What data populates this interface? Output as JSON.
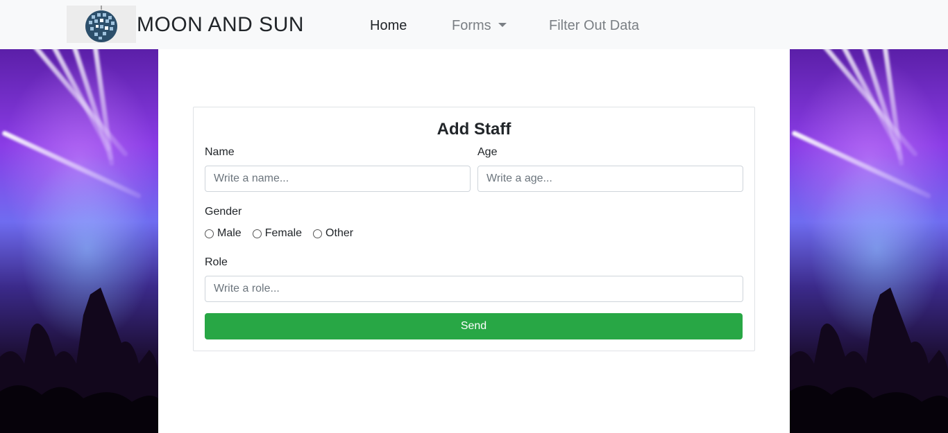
{
  "navbar": {
    "brand": "MOON AND SUN",
    "logo_icon": "disco-ball-icon",
    "links": [
      {
        "label": "Home",
        "active": true
      },
      {
        "label": "Forms",
        "dropdown": true
      },
      {
        "label": "Filter Out Data"
      }
    ]
  },
  "form": {
    "title": "Add Staff",
    "name_label": "Name",
    "name_placeholder": "Write a name...",
    "age_label": "Age",
    "age_placeholder": "Write a age...",
    "gender_label": "Gender",
    "gender_options": [
      "Male",
      "Female",
      "Other"
    ],
    "role_label": "Role",
    "role_placeholder": "Write a role...",
    "submit_label": "Send"
  },
  "colors": {
    "navbar_bg": "#f8f9fa",
    "send_button": "#28a745",
    "background_image": "concert-crowd-purple-lights"
  }
}
